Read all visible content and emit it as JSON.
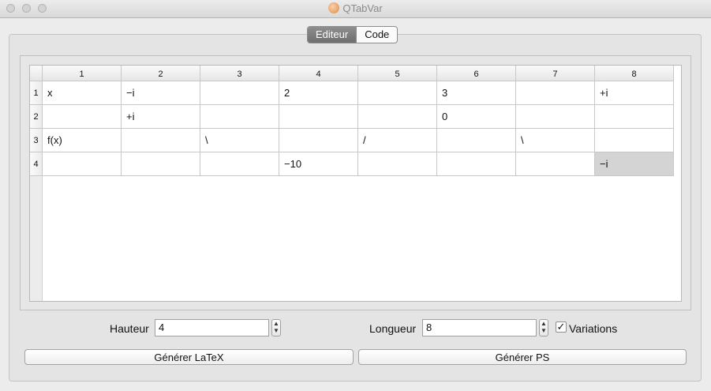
{
  "window": {
    "title": "QTabVar"
  },
  "tabs": [
    {
      "label": "Editeur",
      "active": true
    },
    {
      "label": "Code",
      "active": false
    }
  ],
  "table": {
    "column_headers": [
      "1",
      "2",
      "3",
      "4",
      "5",
      "6",
      "7",
      "8"
    ],
    "row_headers": [
      "1",
      "2",
      "3",
      "4"
    ],
    "rows": [
      [
        "x",
        "−i",
        "",
        "2",
        "",
        "3",
        "",
        "+i"
      ],
      [
        "",
        "+i",
        "",
        "",
        "",
        "0",
        "",
        ""
      ],
      [
        "f(x)",
        "",
        "\\",
        "",
        "/",
        "",
        "\\",
        ""
      ],
      [
        "",
        "",
        "",
        "−10",
        "",
        "",
        "",
        "−i"
      ]
    ],
    "selected_cell": {
      "row": 4,
      "column": 8
    }
  },
  "form": {
    "hauteur_label": "Hauteur",
    "hauteur_value": "4",
    "longueur_label": "Longueur",
    "longueur_value": "8",
    "variations_label": "Variations",
    "variations_checked": true
  },
  "buttons": {
    "latex_label": "Générer LaTeX",
    "ps_label": "Générer PS"
  }
}
